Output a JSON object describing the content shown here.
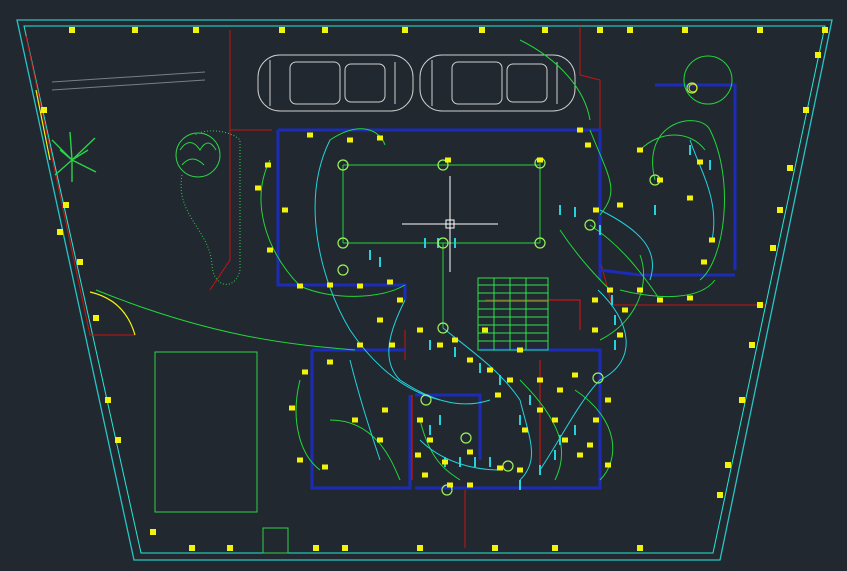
{
  "viewport": {
    "background": "#212830",
    "cursor": "crosshair-cursor"
  },
  "colors": {
    "boundary_outer": "#27c4c4",
    "boundary_inner": "#25e8d6",
    "wiring": "#22d63a",
    "wall": "#1c2bb8",
    "wall_red": "#c81414",
    "fixture": "#f2f20a",
    "lamp": "#9cf25a",
    "furniture": "#cfcfcf",
    "stair": "#2ee24a",
    "circuit_cyan": "#24d2dc"
  },
  "layers": [
    {
      "name": "site-boundary"
    },
    {
      "name": "walls"
    },
    {
      "name": "lighting-fixtures"
    },
    {
      "name": "wiring"
    },
    {
      "name": "landscape"
    },
    {
      "name": "cars"
    }
  ]
}
